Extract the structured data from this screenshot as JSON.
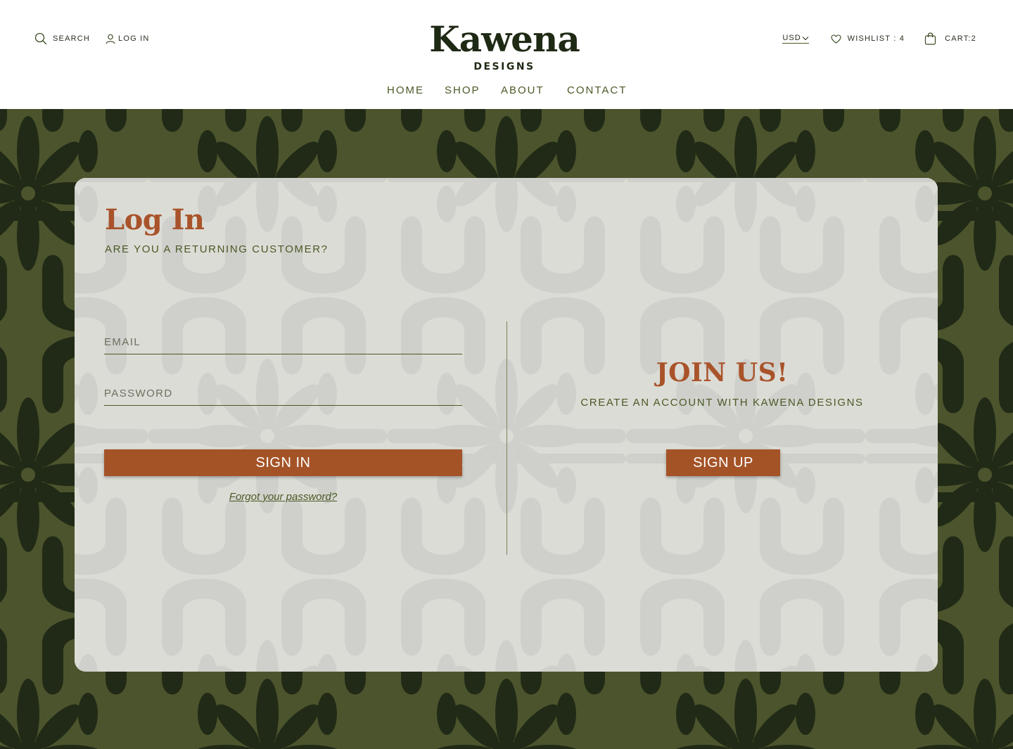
{
  "header": {
    "search_label": "SEARCH",
    "login_label": "LOG IN",
    "brand_name": "Kawena",
    "brand_sub": "DESIGNS",
    "currency": "USD",
    "wishlist_label": "WISHLIST : 4",
    "cart_label": "CART:2"
  },
  "nav": {
    "items": [
      {
        "label": "HOME"
      },
      {
        "label": "SHOP"
      },
      {
        "label": "ABOUT"
      },
      {
        "label": "CONTACT"
      }
    ]
  },
  "login": {
    "title": "Log In",
    "subtitle": "ARE YOU A RETURNING CUSTOMER?",
    "email_placeholder": "EMAIL",
    "password_placeholder": "PASSWORD",
    "sign_in_label": "SIGN IN",
    "forgot_label": "Forgot your password?"
  },
  "join": {
    "title": "JOIN US!",
    "subtitle": "CREATE AN ACCOUNT WITH KAWENA DESIGNS",
    "sign_up_label": "SIGN UP"
  },
  "colors": {
    "brand_dark": "#1f2a15",
    "olive": "#4b542c",
    "pattern_dark": "#212a16",
    "accent": "#a45327",
    "panel": "#e2e2de"
  },
  "icons": {
    "search": "search-icon",
    "user": "user-icon",
    "chevron": "chevron-down-icon",
    "heart": "heart-icon",
    "bag": "shopping-bag-icon"
  }
}
